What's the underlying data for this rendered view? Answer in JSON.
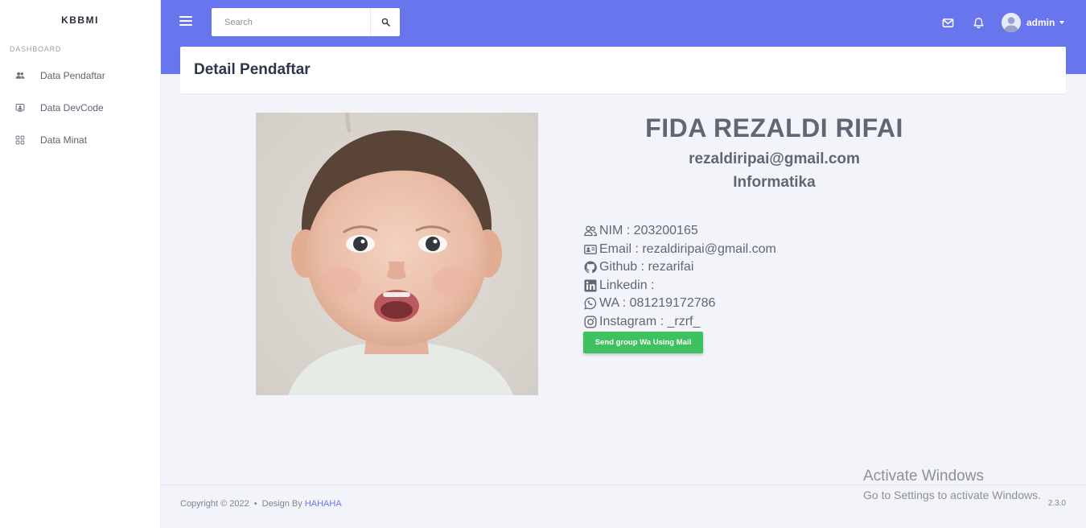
{
  "sidebar": {
    "brand": "KBBMI",
    "section_label": "DASHBOARD",
    "items": [
      {
        "label": "Data Pendaftar",
        "icon": "users-icon"
      },
      {
        "label": "Data DevCode",
        "icon": "monitor-user-icon"
      },
      {
        "label": "Data Minat",
        "icon": "grid-icon"
      }
    ]
  },
  "topbar": {
    "search_placeholder": "Search",
    "user_name": "admin",
    "accent_color": "#6876ee"
  },
  "page": {
    "title": "Detail Pendaftar"
  },
  "profile": {
    "name": "FIDA REZALDI RIFAI",
    "email": "rezaldiripai@gmail.com",
    "major": "Informatika",
    "details": [
      {
        "icon": "user-group-icon",
        "text": "NIM : 203200165"
      },
      {
        "icon": "id-card-icon",
        "text": "Email : rezaldiripai@gmail.com"
      },
      {
        "icon": "github-icon",
        "text": "Github : rezarifai"
      },
      {
        "icon": "linkedin-icon",
        "text": "Linkedin :"
      },
      {
        "icon": "whatsapp-icon",
        "text": "WA : 081219172786"
      },
      {
        "icon": "instagram-icon",
        "text": "Instagram : _rzrf_"
      }
    ],
    "send_button": "Send group Wa Using Mail",
    "send_button_color": "#3ec25f"
  },
  "footer": {
    "copyright": "Copyright © 2022",
    "design_by": "Design By",
    "design_link": "HAHAHA",
    "version": "2.3.0"
  },
  "watermark": {
    "title": "Activate Windows",
    "subtitle": "Go to Settings to activate Windows."
  }
}
